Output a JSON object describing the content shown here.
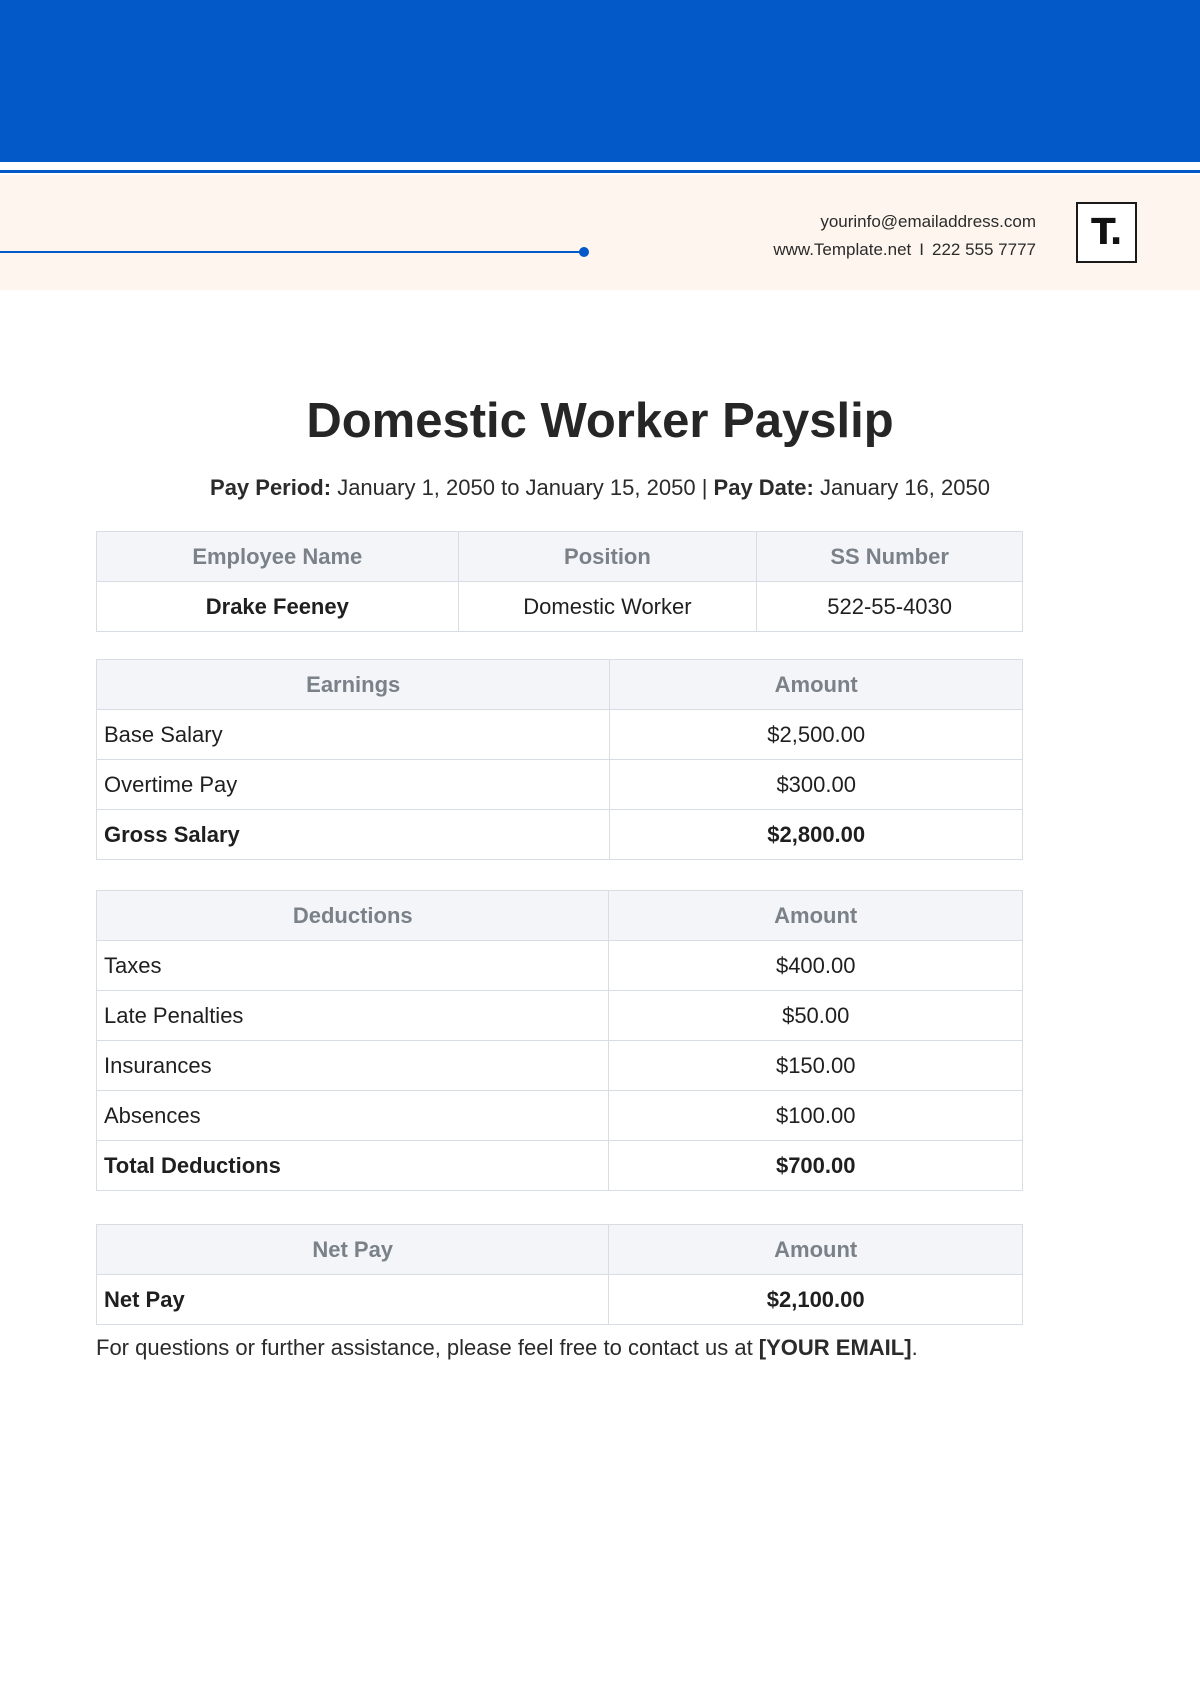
{
  "header": {
    "email": "yourinfo@emailaddress.com",
    "website": "www.Template.net",
    "separator": "I",
    "phone": "222 555 7777",
    "logo_text": "T.",
    "brand_color": "#0259c7",
    "band_color": "#fdf5ee"
  },
  "document": {
    "title": "Domestic Worker Payslip",
    "pay_period_label": "Pay Period:",
    "pay_period_value": "January 1, 2050 to January 15, 2050",
    "divider": "|",
    "pay_date_label": "Pay Date:",
    "pay_date_value": "January 16, 2050"
  },
  "employee_table": {
    "headers": [
      "Employee Name",
      "Position",
      "SS Number"
    ],
    "row": [
      "Drake Feeney",
      "Domestic Worker",
      "522-55-4030"
    ]
  },
  "earnings_table": {
    "headers": [
      "Earnings",
      "Amount"
    ],
    "rows": [
      [
        "Base Salary",
        "$2,500.00"
      ],
      [
        "Overtime Pay",
        "$300.00"
      ]
    ],
    "total": [
      "Gross Salary",
      "$2,800.00"
    ]
  },
  "deductions_table": {
    "headers": [
      "Deductions",
      "Amount"
    ],
    "rows": [
      [
        "Taxes",
        "$400.00"
      ],
      [
        "Late Penalties",
        "$50.00"
      ],
      [
        "Insurances",
        "$150.00"
      ],
      [
        "Absences",
        "$100.00"
      ]
    ],
    "total": [
      "Total Deductions",
      "$700.00"
    ]
  },
  "netpay_table": {
    "headers": [
      "Net Pay",
      "Amount"
    ],
    "total": [
      "Net Pay",
      "$2,100.00"
    ]
  },
  "footer": {
    "text": "For questions or further assistance, please feel free to contact us at ",
    "email_placeholder": "[YOUR EMAIL]",
    "end": "."
  }
}
